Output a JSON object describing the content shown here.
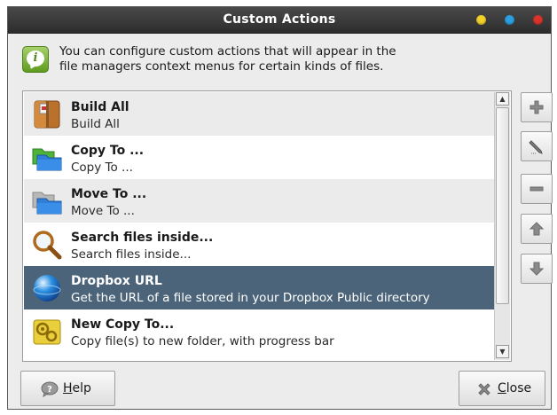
{
  "window": {
    "title": "Custom Actions",
    "title_buttons": [
      {
        "name": "minimize",
        "color": "#f2d12a"
      },
      {
        "name": "maximize",
        "color": "#2c9fe0"
      },
      {
        "name": "close",
        "color": "#d9342b"
      }
    ]
  },
  "info": {
    "icon": "info-icon",
    "line1": "You can configure custom actions that will appear in the",
    "line2": "file managers context menus for certain kinds of files."
  },
  "actions": [
    {
      "name": "Build All",
      "description": "Build All",
      "icon": "archive-icon"
    },
    {
      "name": "Copy To ...",
      "description": "Copy To ...",
      "icon": "folder-copy-icon"
    },
    {
      "name": "Move To ...",
      "description": "Move To ...",
      "icon": "folder-move-icon"
    },
    {
      "name": "Search files inside...",
      "description": "Search files inside...",
      "icon": "magnifier-icon"
    },
    {
      "name": "Dropbox URL",
      "description": "Get the URL of a file stored in your Dropbox Public directory",
      "icon": "globe-icon",
      "selected": true
    },
    {
      "name": "New Copy To...",
      "description": "Copy file(s) to new folder, with progress bar",
      "icon": "gear-folder-icon"
    }
  ],
  "side_buttons": [
    "add-icon",
    "edit-icon",
    "remove-icon",
    "move-up-icon",
    "move-down-icon"
  ],
  "buttons": {
    "help_prefix": "",
    "help_underlined": "H",
    "help_rest": "elp",
    "close_underlined": "C",
    "close_rest": "lose"
  },
  "colors": {
    "selection": "#4b6479",
    "titlebar": "#2b2b2b"
  }
}
